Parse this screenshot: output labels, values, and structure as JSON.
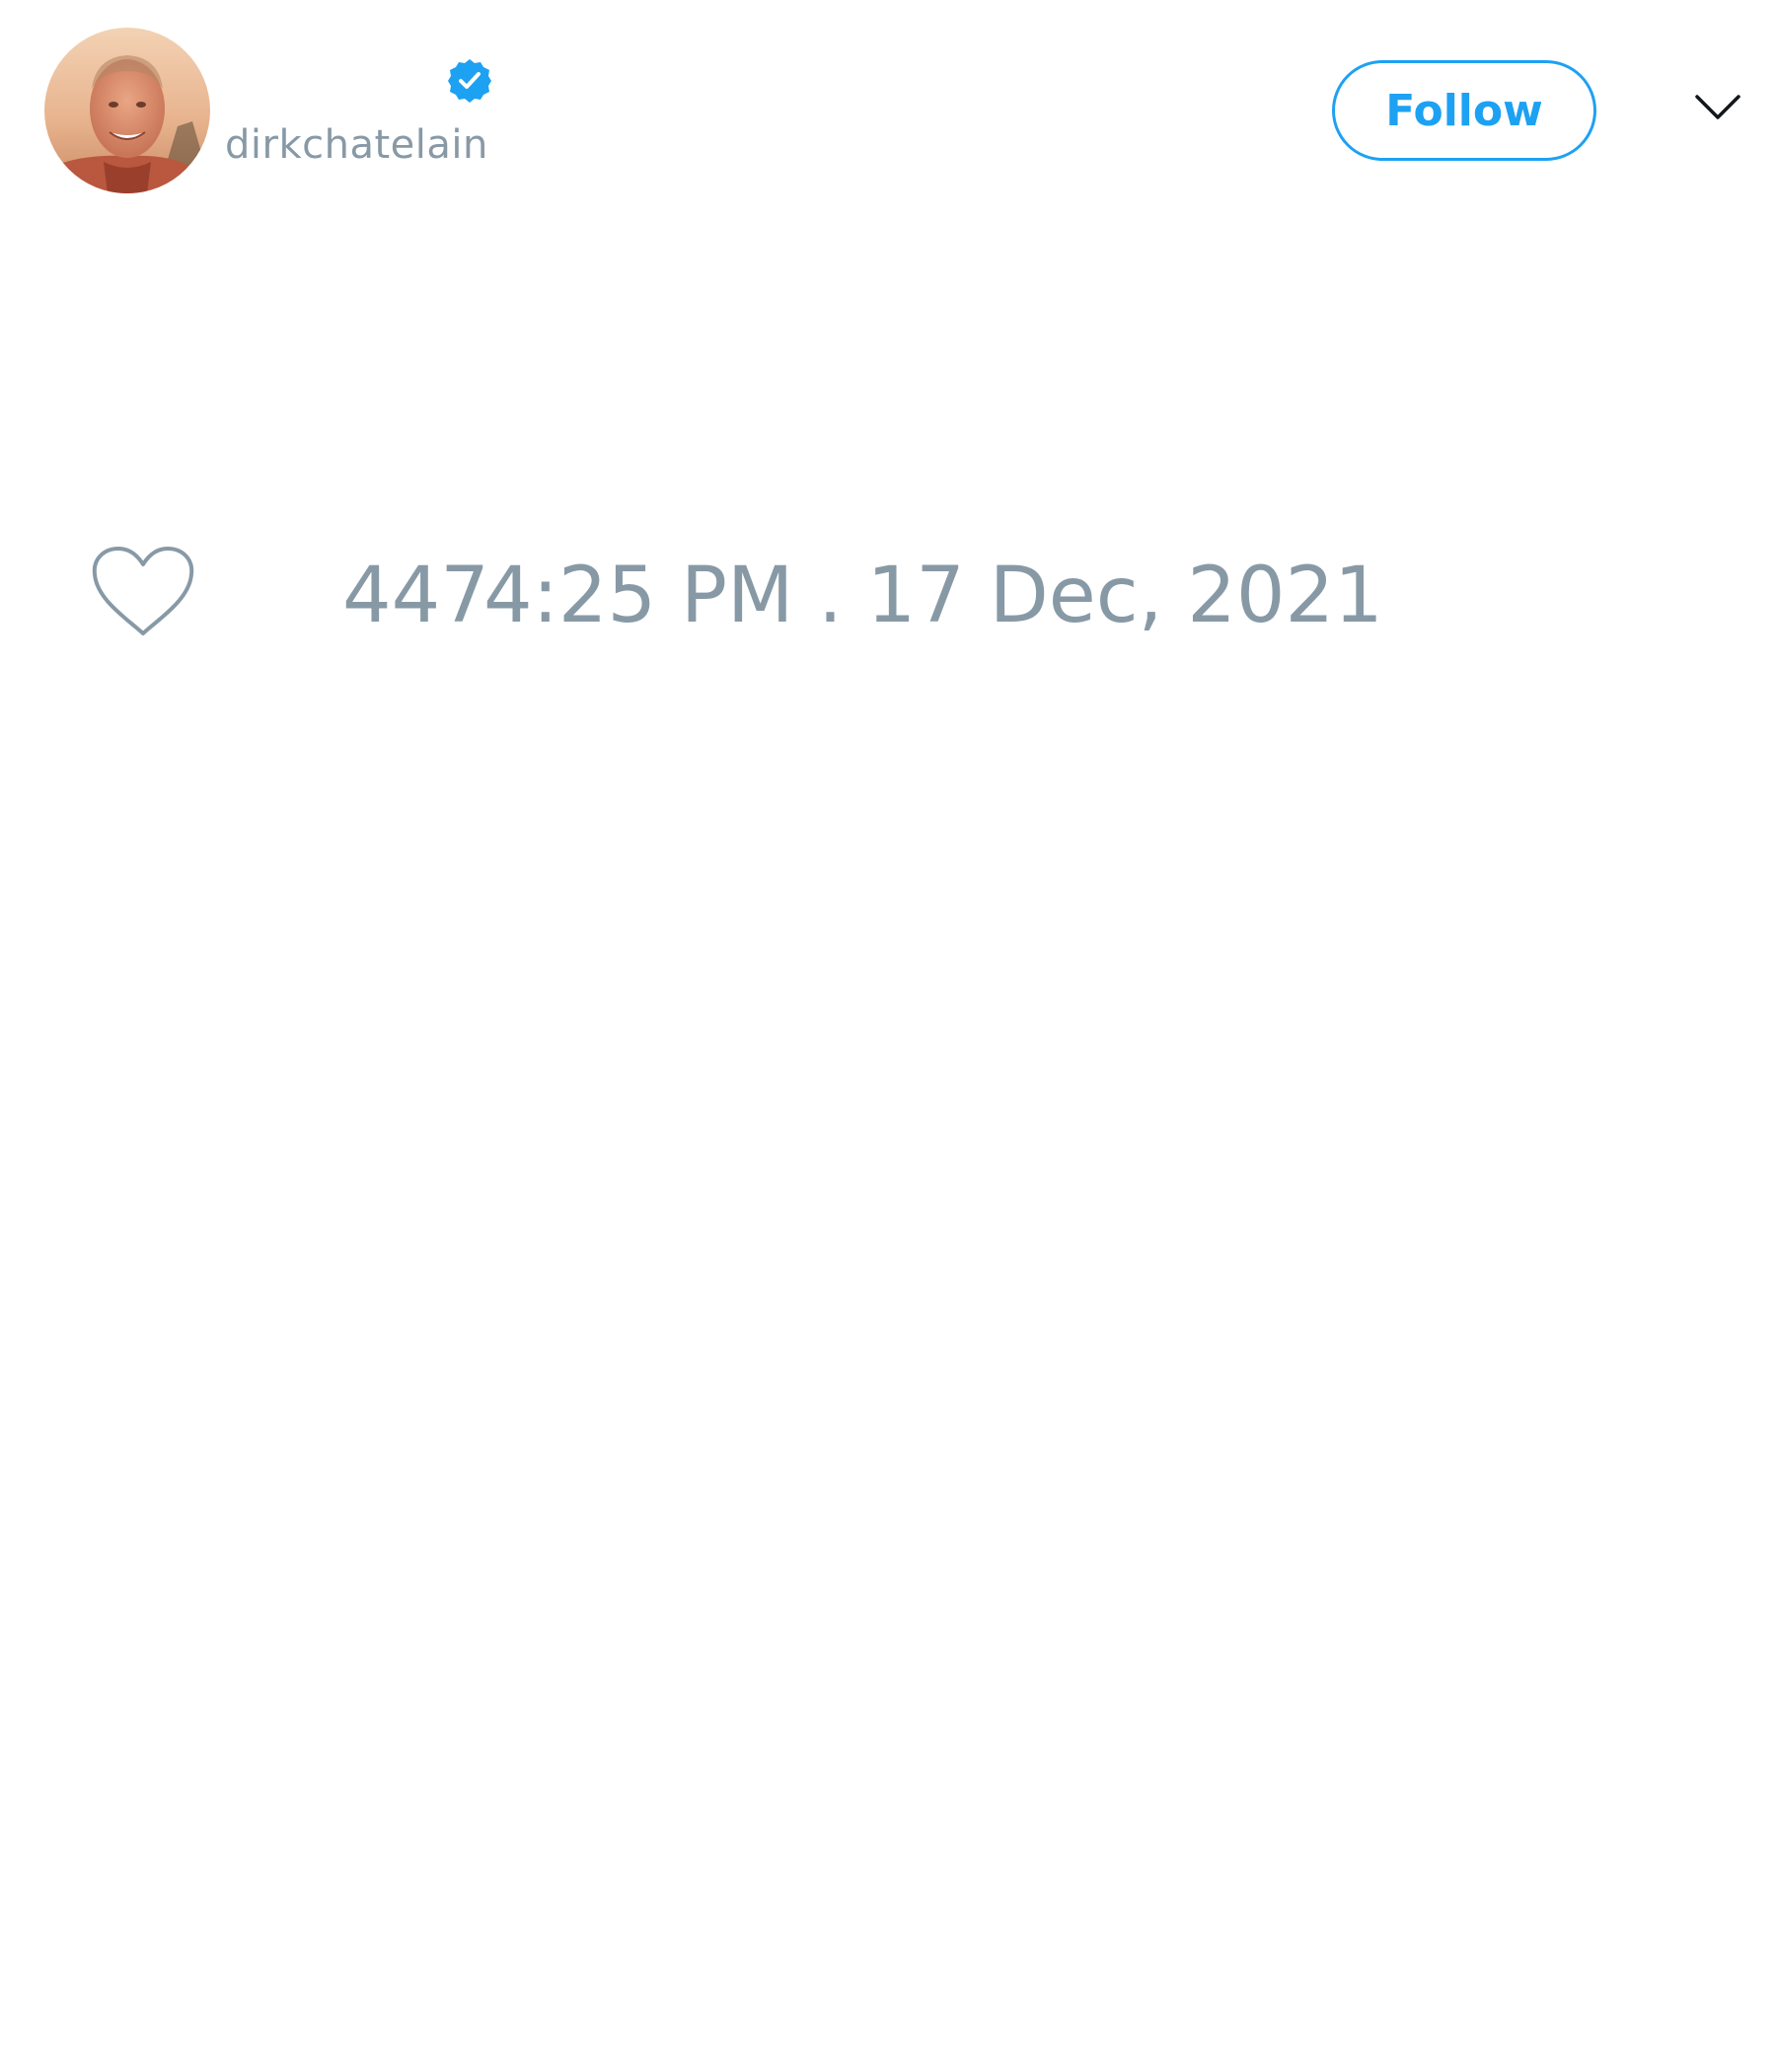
{
  "author": {
    "display_name": "",
    "handle": "dirkchatelain",
    "verified": true,
    "avatar_icon": "profile-photo"
  },
  "header": {
    "follow_label": "Follow",
    "menu_icon": "chevron-down-icon"
  },
  "footer": {
    "like_icon": "heart-outline-icon",
    "like_count": "447",
    "timestamp": "4:25 PM . 17 Dec, 2021"
  },
  "colors": {
    "accent": "#1da1f2",
    "muted_text": "#8899a6",
    "background": "#ffffff"
  }
}
